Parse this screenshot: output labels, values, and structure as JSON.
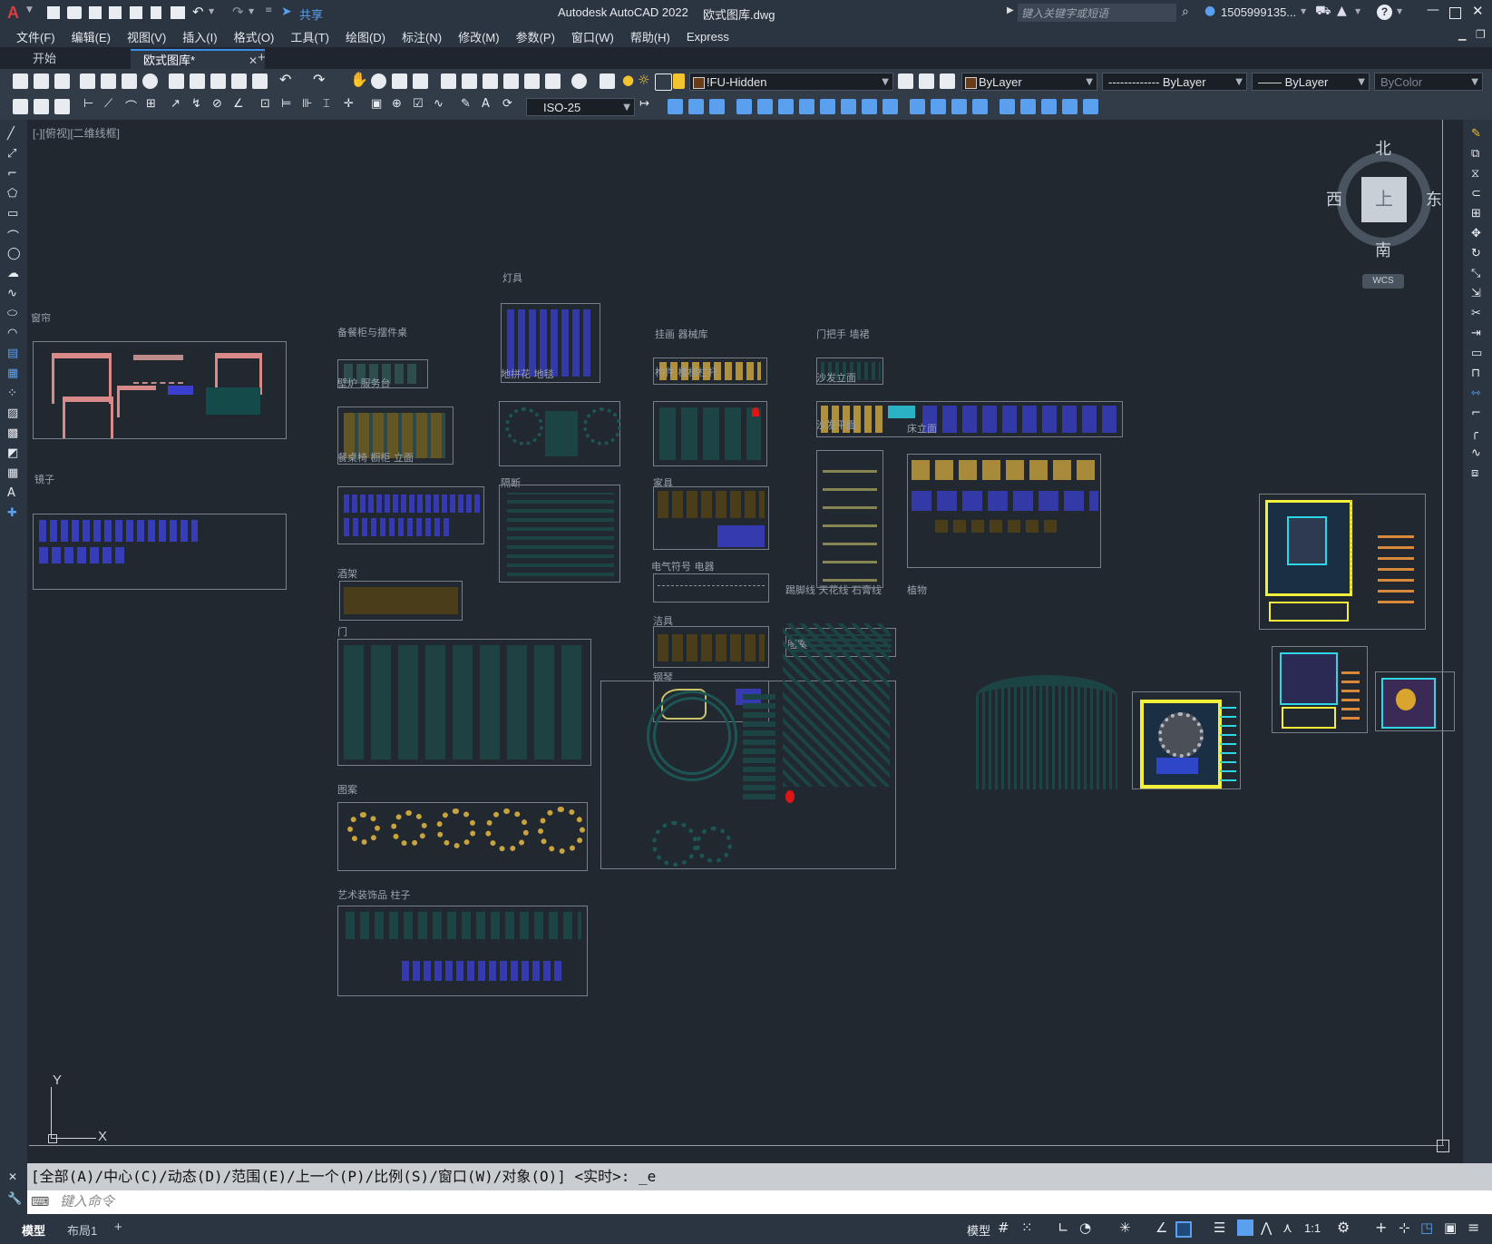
{
  "app": {
    "logo_text": "A",
    "share_label": "共享",
    "title": "Autodesk AutoCAD 2022",
    "filename": "欧式图库.dwg",
    "search_placeholder": "键入关键字或短语",
    "user": "1505999135...",
    "help_icon": "?"
  },
  "menu": [
    "文件(F)",
    "编辑(E)",
    "视图(V)",
    "插入(I)",
    "格式(O)",
    "工具(T)",
    "绘图(D)",
    "标注(N)",
    "修改(M)",
    "参数(P)",
    "窗口(W)",
    "帮助(H)",
    "Express"
  ],
  "tabs": {
    "start": "开始",
    "doc": "欧式图库*",
    "add": "+"
  },
  "layer": {
    "current": "!FU-Hidden",
    "color": "ByLayer",
    "linetype": "------------- ByLayer",
    "lineweight": "—— ByLayer",
    "plotstyle": "ByColor"
  },
  "dimstyle": "ISO-25",
  "viewport_label": "[-][俯视][二维线框]",
  "viewcube": {
    "north": "北",
    "south": "南",
    "east": "东",
    "west": "西",
    "top": "上",
    "wcs": "WCS"
  },
  "ucs": {
    "x": "X",
    "y": "Y"
  },
  "drawing_labels": {
    "curtain": "窗帘",
    "mirror": "镜子",
    "sideboard": "备餐柜与摆件桌",
    "fireplace": "壁炉 服务台",
    "dining": "餐桌椅 橱柜 立面",
    "wine": "酒架",
    "door": "门",
    "pattern1": "图案",
    "art": "艺术装饰品 柱子",
    "lamps": "灯具",
    "floor": "地拼花 地毯",
    "partition": "隔断",
    "painting": "挂画 器械库",
    "component": "构件 楼梯栏杆",
    "furniture": "家具",
    "electric": "电气符号 电器",
    "sanitary": "洁具",
    "piano": "钢琴",
    "molding": "踢脚线 天花线 石膏线",
    "plant": "植物",
    "pattern2": "图案",
    "door_handle": "门把手 墙裙",
    "sofa_elev": "沙发立面",
    "sofa_plan": "沙发平面",
    "bed_elev": "床立面"
  },
  "command": {
    "history": "[全部(A)/中心(C)/动态(D)/范围(E)/上一个(P)/比例(S)/窗口(W)/对象(O)] <实时>: _e",
    "placeholder": "键入命令"
  },
  "status": {
    "model_tab": "模型",
    "layout_tab": "布局1",
    "add": "+",
    "model_btn": "模型",
    "scale": "1:1"
  },
  "colors": {
    "accent": "#3a8ee6",
    "canvas": "#212830",
    "gold": "#c9a33c",
    "blue": "#3b3fd0",
    "pink": "#d88a88",
    "yellow": "#f4f03a",
    "cyan": "#2fd6e8"
  }
}
